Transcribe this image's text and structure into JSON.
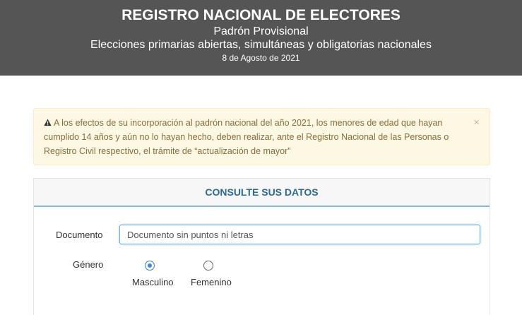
{
  "header": {
    "title": "REGISTRO NACIONAL DE ELECTORES",
    "subtitle": "Padrón Provisional",
    "election": "Elecciones primarias abiertas, simultáneas y obligatorias nacionales",
    "date": "8 de Agosto de 2021"
  },
  "alert": {
    "icon": "warning-icon",
    "text": "A los efectos de su incorporación al padrón nacional del año 2021, los menores de edad que hayan cumplido 14 años y aún no lo hayan hecho, deben realizar, ante el Registro Nacional de las Personas o Registro Civil respectivo, el trámite de “actualización de mayor”",
    "close": "×"
  },
  "form": {
    "heading": "CONSULTE SUS DATOS",
    "documento_label": "Documento",
    "documento_placeholder": "Documento sin puntos ni letras",
    "documento_value": "",
    "genero_label": "Género",
    "genero_options": [
      "Masculino",
      "Femenino"
    ],
    "genero_selected": "Masculino"
  },
  "colors": {
    "header_bg": "#555555",
    "alert_bg": "#fcf8e3",
    "alert_text": "#8a6d3b",
    "accent": "#2e6a96",
    "radio_selected": "#3b87d8"
  }
}
